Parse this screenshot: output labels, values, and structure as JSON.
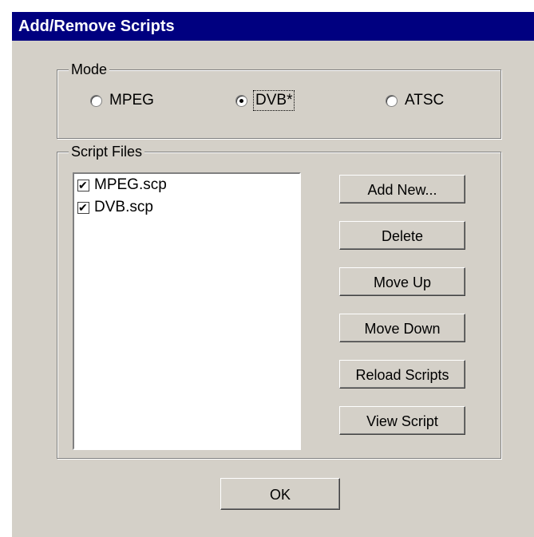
{
  "window": {
    "title": "Add/Remove Scripts"
  },
  "mode": {
    "label": "Mode",
    "options": [
      {
        "label": "MPEG",
        "checked": false
      },
      {
        "label": "DVB*",
        "checked": true
      },
      {
        "label": "ATSC",
        "checked": false
      }
    ]
  },
  "script_files": {
    "label": "Script Files",
    "items": [
      {
        "label": "MPEG.scp",
        "checked": true
      },
      {
        "label": "DVB.scp",
        "checked": true
      }
    ]
  },
  "buttons": {
    "add_new": "Add New...",
    "delete": "Delete",
    "move_up": "Move Up",
    "move_down": "Move Down",
    "reload_scripts": "Reload Scripts",
    "view_script": "View Script",
    "ok": "OK"
  }
}
